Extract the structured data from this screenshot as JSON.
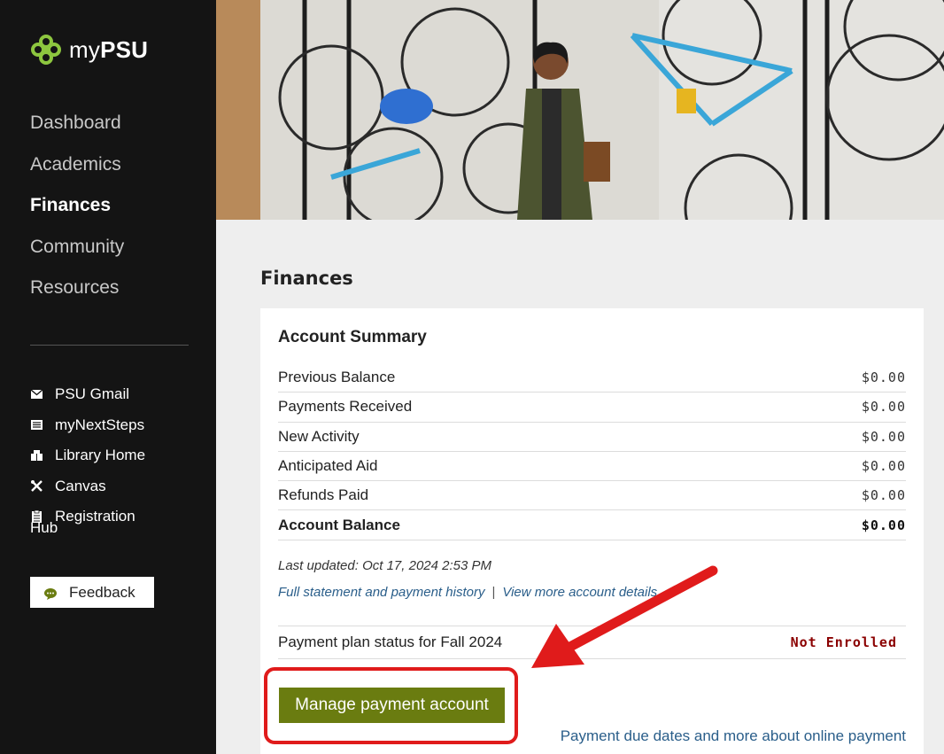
{
  "sidebar": {
    "logo_text_prefix": "my",
    "logo_text_bold": "PSU",
    "nav": [
      {
        "label": "Dashboard"
      },
      {
        "label": "Academics"
      },
      {
        "label": "Finances",
        "active": true
      },
      {
        "label": "Community"
      },
      {
        "label": "Resources"
      }
    ],
    "links": [
      {
        "label": "PSU Gmail",
        "icon": "envelope-icon"
      },
      {
        "label": "myNextSteps",
        "icon": "list-icon"
      },
      {
        "label": "Library Home",
        "icon": "book-icon"
      },
      {
        "label": "Canvas",
        "icon": "tools-icon"
      },
      {
        "label": "Registration",
        "label_wrap": "Hub",
        "icon": "clipboard-icon"
      }
    ],
    "feedback_label": "Feedback"
  },
  "main": {
    "page_title": "Finances",
    "card_title": "Account Summary",
    "summary_rows": [
      {
        "label": "Previous Balance",
        "value": "$0.00"
      },
      {
        "label": "Payments Received",
        "value": "$0.00"
      },
      {
        "label": "New Activity",
        "value": "$0.00"
      },
      {
        "label": "Anticipated Aid",
        "value": "$0.00"
      },
      {
        "label": "Refunds Paid",
        "value": "$0.00"
      },
      {
        "label": "Account Balance",
        "value": "$0.00"
      }
    ],
    "last_updated": "Last updated: Oct 17, 2024 2:53 PM",
    "statement_link": "Full statement and payment history",
    "separator": "|",
    "account_details_link": "View more account details",
    "plan_label": "Payment plan status for Fall 2024",
    "plan_status": "Not Enrolled",
    "manage_button": "Manage payment account",
    "due_dates_link": "Payment due dates and more about online payment"
  },
  "colors": {
    "sidebar_bg": "#141414",
    "accent_green": "#6a7c10",
    "status_red": "#8b0000",
    "link_blue": "#2a5e8a",
    "annotation_red": "#e01b1b"
  }
}
